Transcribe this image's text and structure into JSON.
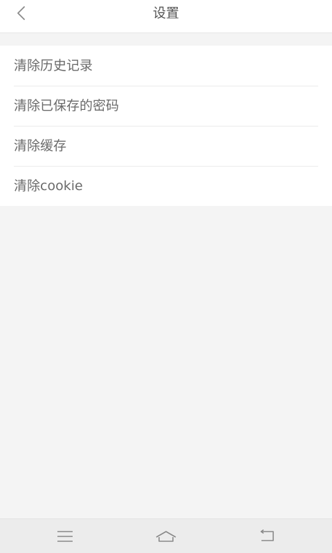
{
  "header": {
    "title": "设置",
    "back_icon": "chevron-left-icon"
  },
  "menu": {
    "items": [
      {
        "label": "清除历史记录"
      },
      {
        "label": "清除已保存的密码"
      },
      {
        "label": "清除缓存"
      },
      {
        "label": "清除cookie"
      }
    ]
  },
  "navbar": {
    "icons": [
      "menu-icon",
      "home-icon",
      "return-icon"
    ]
  },
  "colors": {
    "background": "#f4f4f4",
    "surface": "#ffffff",
    "text": "#6a6a6a",
    "divider": "#ebebeb"
  }
}
